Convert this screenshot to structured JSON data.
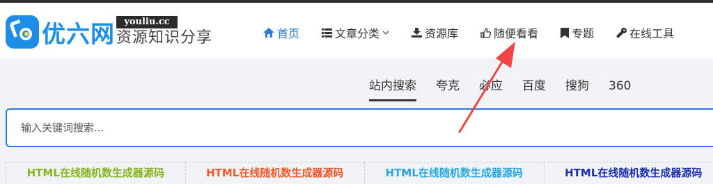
{
  "logo": {
    "name": "优六网",
    "domain": "youliu.cc",
    "slogan": "资源知识分享"
  },
  "nav": {
    "items": [
      {
        "label": "首页",
        "icon": "home-icon",
        "active": true
      },
      {
        "label": "文章分类",
        "icon": "list-icon",
        "has_dropdown": true
      },
      {
        "label": "资源库",
        "icon": "download-icon"
      },
      {
        "label": "随便看看",
        "icon": "thumbs-up-icon"
      },
      {
        "label": "专题",
        "icon": "bookmark-icon"
      },
      {
        "label": "在线工具",
        "icon": "wrench-icon"
      }
    ]
  },
  "search": {
    "tabs": [
      "站内搜索",
      "夸克",
      "必应",
      "百度",
      "搜狗",
      "360"
    ],
    "active_tab": "站内搜索",
    "placeholder": "输入关键词搜索..."
  },
  "links": [
    {
      "label": "HTML在线随机数生成器源码",
      "color": "#86b31f"
    },
    {
      "label": "HTML在线随机数生成器源码",
      "color": "#f0582a"
    },
    {
      "label": "HTML在线随机数生成器源码",
      "color": "#27a6e3"
    },
    {
      "label": "HTML在线随机数生成器源码",
      "color": "#1b2fa8"
    }
  ],
  "colors": {
    "brand": "#1d8ee6",
    "accent": "#2b7bd8",
    "annotation_arrow": "#f04545"
  }
}
